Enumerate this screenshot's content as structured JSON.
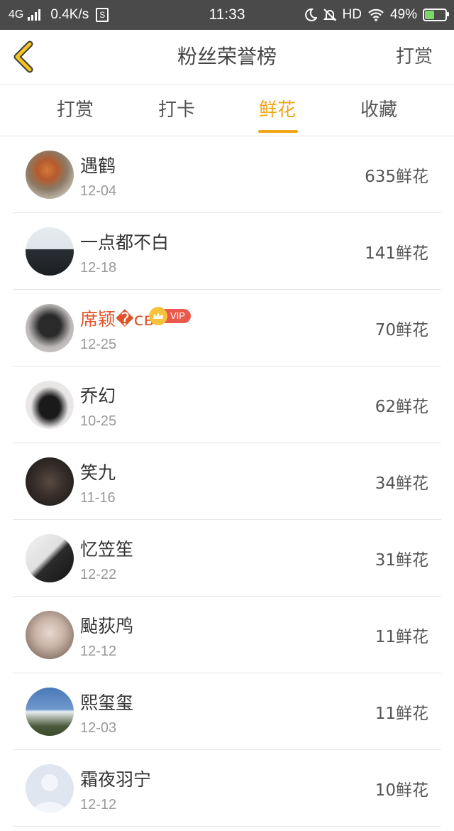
{
  "status_bar": {
    "network": "4G",
    "speed": "0.4K/s",
    "s_icon": "S",
    "time": "11:33",
    "hd": "HD",
    "battery": "49%",
    "battery_level": 0.49
  },
  "header": {
    "title": "粉丝荣誉榜",
    "right_label": "打赏"
  },
  "tabs": [
    {
      "label": "打赏",
      "active": false
    },
    {
      "label": "打卡",
      "active": false
    },
    {
      "label": "鲜花",
      "active": true
    },
    {
      "label": "收藏",
      "active": false
    }
  ],
  "fans": [
    {
      "name": "遇鹤",
      "date": "12-04",
      "count": "635鲜花",
      "vip": false
    },
    {
      "name": "一点都不白",
      "date": "12-18",
      "count": "141鲜花",
      "vip": false
    },
    {
      "name": "席颖�св",
      "date": "12-25",
      "count": "70鲜花",
      "vip": true,
      "vip_label": "VIP"
    },
    {
      "name": "乔幻",
      "date": "10-25",
      "count": "62鲜花",
      "vip": false
    },
    {
      "name": "笑九",
      "date": "11-16",
      "count": "34鲜花",
      "vip": false
    },
    {
      "name": "忆笠笙",
      "date": "12-22",
      "count": "31鲜花",
      "vip": false
    },
    {
      "name": "颭荻鸤",
      "date": "12-12",
      "count": "11鲜花",
      "vip": false
    },
    {
      "name": "熙玺玺",
      "date": "12-03",
      "count": "11鲜花",
      "vip": false
    },
    {
      "name": "霜夜羽宁",
      "date": "12-12",
      "count": "10鲜花",
      "vip": false
    }
  ],
  "colors": {
    "accent": "#f2a51a",
    "vip_name": "#e0542a",
    "vip_tag": "#ea5a4c",
    "statusbar": "#4a4a4a"
  }
}
